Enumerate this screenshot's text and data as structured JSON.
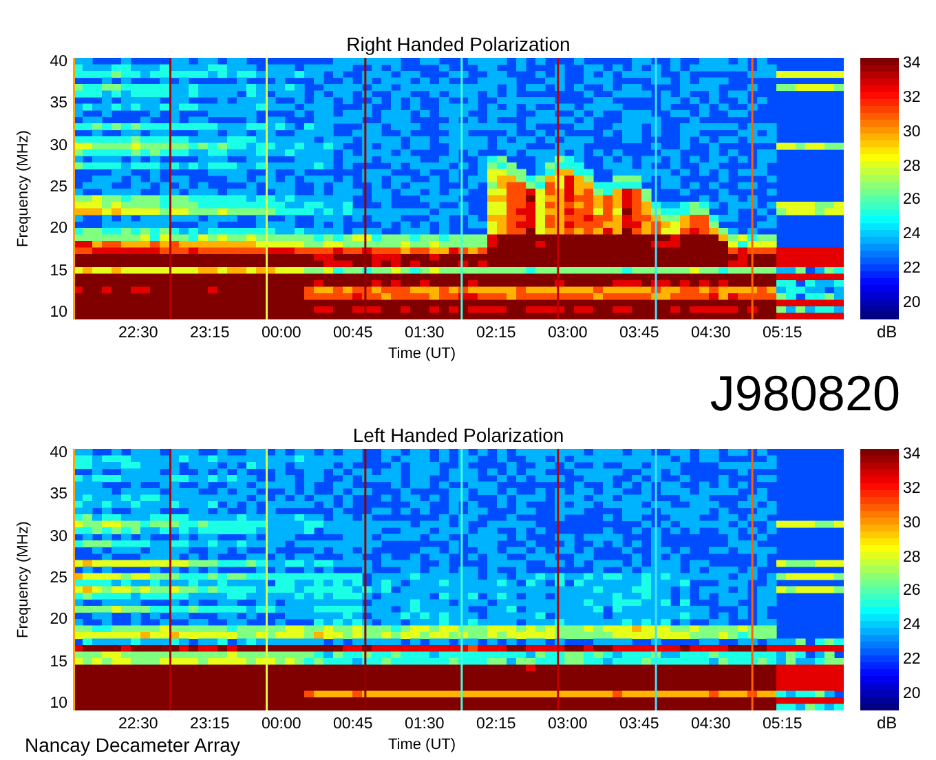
{
  "panels": [
    {
      "kind": "burst",
      "title": "Right Handed Polarization",
      "ylabel": "Frequency (MHz)",
      "yticks": [
        "40",
        "35",
        "30",
        "25",
        "20",
        "15",
        "10"
      ],
      "xticks": [
        "22:30",
        "23:15",
        "00:00",
        "00:45",
        "01:30",
        "02:15",
        "03:00",
        "03:45",
        "04:30",
        "05:15"
      ],
      "xlabel": "Time (UT)",
      "colorbar_ticks": [
        "34",
        "32",
        "30",
        "28",
        "26",
        "24",
        "22",
        "20"
      ],
      "colorbar_unit": "dB"
    },
    {
      "kind": "quiet",
      "title": "Left Handed Polarization",
      "ylabel": "Frequency (MHz)",
      "yticks": [
        "40",
        "35",
        "30",
        "25",
        "20",
        "15",
        "10"
      ],
      "xticks": [
        "22:30",
        "23:15",
        "00:00",
        "00:45",
        "01:30",
        "02:15",
        "03:00",
        "03:45",
        "04:30",
        "05:15"
      ],
      "xlabel": "Time (UT)",
      "colorbar_ticks": [
        "34",
        "32",
        "30",
        "28",
        "26",
        "24",
        "22",
        "20"
      ],
      "colorbar_unit": "dB"
    }
  ],
  "event_id": "J980820",
  "instrument": "Nancay Decameter Array"
}
